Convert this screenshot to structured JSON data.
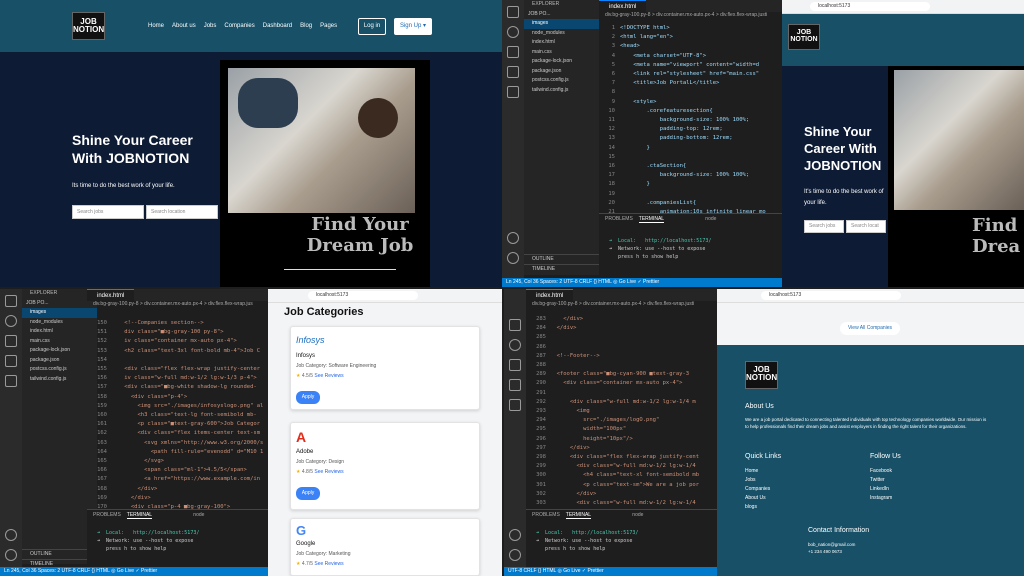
{
  "site": {
    "logo_top": "JOB",
    "logo_bottom": "NOTION",
    "nav": [
      "Home",
      "About us",
      "Jobs",
      "Companies",
      "Dashboard",
      "Blog",
      "Pages"
    ],
    "login": "Log in",
    "signup": "Sign Up",
    "signup_caret": "▾",
    "hero_line1": "Shine Your Career",
    "hero_line2": "With JOBNOTION",
    "hero_sub": "Its time to do the best work of your life.",
    "search_jobs": "Search jobs",
    "search_location": "Search location",
    "dream1": "Find Your",
    "dream2": "Dream Job",
    "q2_hero_line1": "Shine Your",
    "q2_hero_line2": "Career With",
    "q2_hero_line3": "JOBNOTION",
    "q2_hero_sub1": "It's time to do the best work of",
    "q2_hero_sub2": "your life.",
    "q2_search_jobs": "Search jobs",
    "q2_search_loc": "Search locat",
    "q2_dream1": "Find",
    "q2_dream2": "Drea"
  },
  "vscode": {
    "explorer": "EXPLORER",
    "project": "JOB PO...",
    "files": [
      "images",
      "node_modules",
      "index.html",
      "main.css",
      "package-lock.json",
      "package.json",
      "postcss.config.js",
      "tailwind.config.js"
    ],
    "tab": "index.html",
    "crumb1": "div.bg-gray-100.py-8 > div.container.mx-auto.px-4 > div.flex.flex-wrap.justi",
    "crumb2": "div.bg-gray-100.py-8 > div.container.mx-auto.px-4 > div.flex.flex-wrap.jus",
    "crumb3": "div.bg-gray-100.py-8 > div.container.mx-auto.px-4 > div.flex.flex-wrap.justi",
    "outline": "OUTLINE",
    "timeline": "TIMELINE",
    "code1": "<!DOCTYPE html>\n<html lang=\"en\">\n<head>\n    <meta charset=\"UTF-8\">\n    <meta name=\"viewport\" content=\"width=d\n    <link rel=\"stylesheet\" href=\"main.css\"\n    <title>Job PortalL</title>\n\n    <style>\n        .corefeaturesection{\n            background-size: 100% 100%;\n            padding-top: 12rem;\n            padding-bottom: 12rem;\n        }\n\n        .ctaSection{\n            background-size: 100% 100%;\n        }\n\n        .companiesList{\n            animation:10s infinite linear mo",
    "ln1": "1\n2\n3\n4\n5\n6\n7\n8\n9\n10\n11\n12\n13\n14\n15\n16\n17\n18\n19\n20\n21",
    "code3": "    <!--Companies section-->\n    div class=\"■bg-gray-100 py-8\">\n    iv class=\"container mx-auto px-4\">\n    <h2 class=\"text-3xl font-bold mb-4\">Job C\n\n    <div class=\"flex flex-wrap justify-center\n    iv class=\"w-full md:w-1/2 lg:w-1/3 p-4\">\n    <div class=\"■bg-white shadow-lg rounded-\n      <div class=\"p-4\">\n        <img src=\"./images/infosyslogo.png\" al\n        <h3 class=\"text-lg font-semibold mb-\n        <p class=\"■text-gray-600\">Job Categor\n        <div class=\"flex items-center text-sm\n          <svg xmlns=\"http://www.w3.org/2000/s\n            <path fill-rule=\"evenodd\" d=\"M10 1\n          </svg>\n          <span class=\"ml-1\">4.5/5</span>\n          <a href=\"https://www.example.com/in\n        </div>\n      </div>\n      <div class=\"p-4 ■bg-gray-100\">",
    "ln3": "150\n151\n152\n153\n154\n155\n156\n157\n158\n159\n160\n161\n162\n163\n164\n165\n166\n167\n168\n169\n170",
    "code4": "    </div>\n  </div>\n\n\n  <!--Footer-->\n\n  <footer class=\"■bg-cyan-900 ■text-gray-3\n    <div class=\"container mx-auto px-4\">\n\n      <div class=\"w-full md:w-1/2 lg:w-1/4 m\n        <img\n          src=\"./images/logO.png\"\n          width=\"100px\"\n          height=\"10px\"/>\n      </div>\n      <div class=\"flex flex-wrap justify-cent\n        <div class=\"w-full md:w-1/2 lg:w-1/4\n          <h4 class=\"text-xl font-semibold mb\n          <p class=\"text-sm\">We are a job por\n        </div>\n        <div class=\"w-full md:w-1/2 lg:w-1/4\n          <h4 class=\"text-xl font-semibold mb",
    "ln4": "283\n284\n285\n286\n287\n288\n289\n290\n291\n292\n293\n294\n295\n296\n297\n298\n299\n300\n301\n302\n303\n304",
    "problems": "PROBLEMS",
    "terminal": "TERMINAL",
    "node": "node",
    "term1": "➜  Local:   http://localhost:5173/",
    "term2": "➜  Network: use --host to expose",
    "term3": "   press h to show help",
    "status2": "Ln 245, Col 36   Spaces: 2   UTF-8   CRLF   {} HTML   ◎ Go Live   ✓ Prettier",
    "status3": "Ln 245, Col 36   Spaces: 2   UTF-8   CRLF   {} HTML   ◎ Go Live   ✓ Prettier",
    "status4": "UTF-8   CRLF   {} HTML   ◎ Go Live   ✓ Prettier"
  },
  "browser": {
    "url": "localhost:5173",
    "jc_title": "Job Categories",
    "cards": [
      {
        "name": "Infosys",
        "cat": "Job Category: Software Engineering",
        "rating": "4.5/5",
        "reviews": "See Reviews",
        "apply": "Apply",
        "logo": "Infosys"
      },
      {
        "name": "Adobe",
        "cat": "Job Category: Design",
        "rating": "4.8/5",
        "reviews": "See Reviews",
        "apply": "Apply",
        "logo": "A"
      },
      {
        "name": "Google",
        "cat": "Job Category: Marketing",
        "rating": "4.7/5",
        "reviews": "See Reviews",
        "apply": "Apply",
        "logo": "G"
      }
    ],
    "view_all": "View All Companies",
    "about_h": "About Us",
    "about_p": "We are a job portal dedicated to connecting talented individuals with top technology companies worldwide. Our mission is to help professionals find their dream jobs and assist employers in finding the right talent for their organizations.",
    "quick_h": "Quick Links",
    "quick": [
      "Home",
      "Jobs",
      "Companies",
      "About Us",
      "blogs"
    ],
    "follow_h": "Follow Us",
    "follow": [
      "Facebook",
      "Twitter",
      "LinkedIn",
      "Instagram"
    ],
    "contact_h": "Contact Information",
    "email": "bob_nation@gmail.com",
    "phone": "+1 234 490 0673"
  },
  "colors": {
    "nav": "#175067",
    "hero_bg": "#0d1b35",
    "accent": "#007acc",
    "apply": "#3b82f6"
  }
}
